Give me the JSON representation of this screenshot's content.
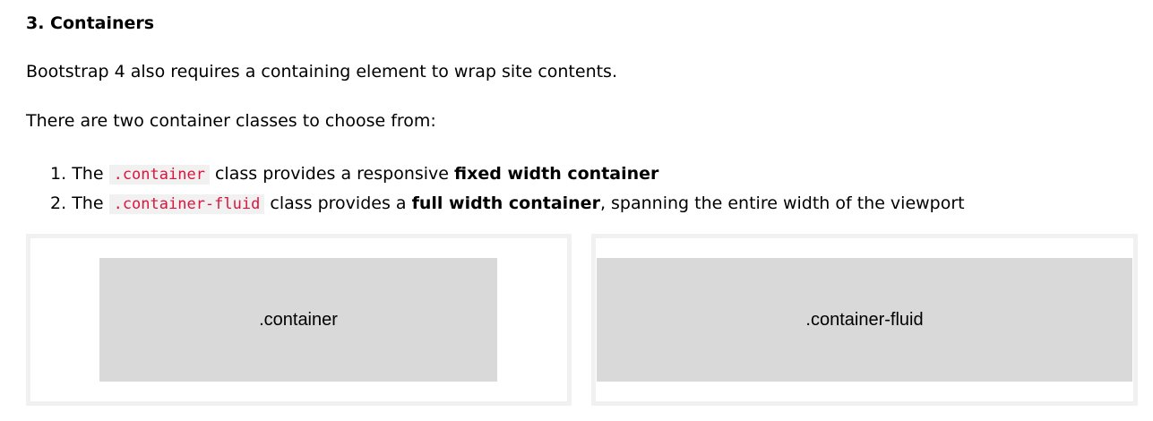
{
  "section": {
    "heading": "3. Containers",
    "paragraph_1": "Bootstrap 4 also requires a containing element to wrap site contents.",
    "paragraph_2": "There are two container classes to choose from:"
  },
  "list": [
    {
      "number": "1.",
      "prefix": "The",
      "code": ".container",
      "text_mid": "class provides a responsive",
      "bold": "fixed width container",
      "text_end": ""
    },
    {
      "number": "2.",
      "prefix": "The",
      "code": ".container-fluid",
      "text_mid": "class provides a",
      "bold": "full width container",
      "text_end": ", spanning the entire width of the viewport"
    }
  ],
  "demos": {
    "container_label": ".container",
    "container_fluid_label": ".container-fluid"
  },
  "colors": {
    "code_text": "#dc143c",
    "code_background": "#f1f1f1",
    "demo_border": "#f1f1f1",
    "demo_inner": "#d9d9d9"
  }
}
